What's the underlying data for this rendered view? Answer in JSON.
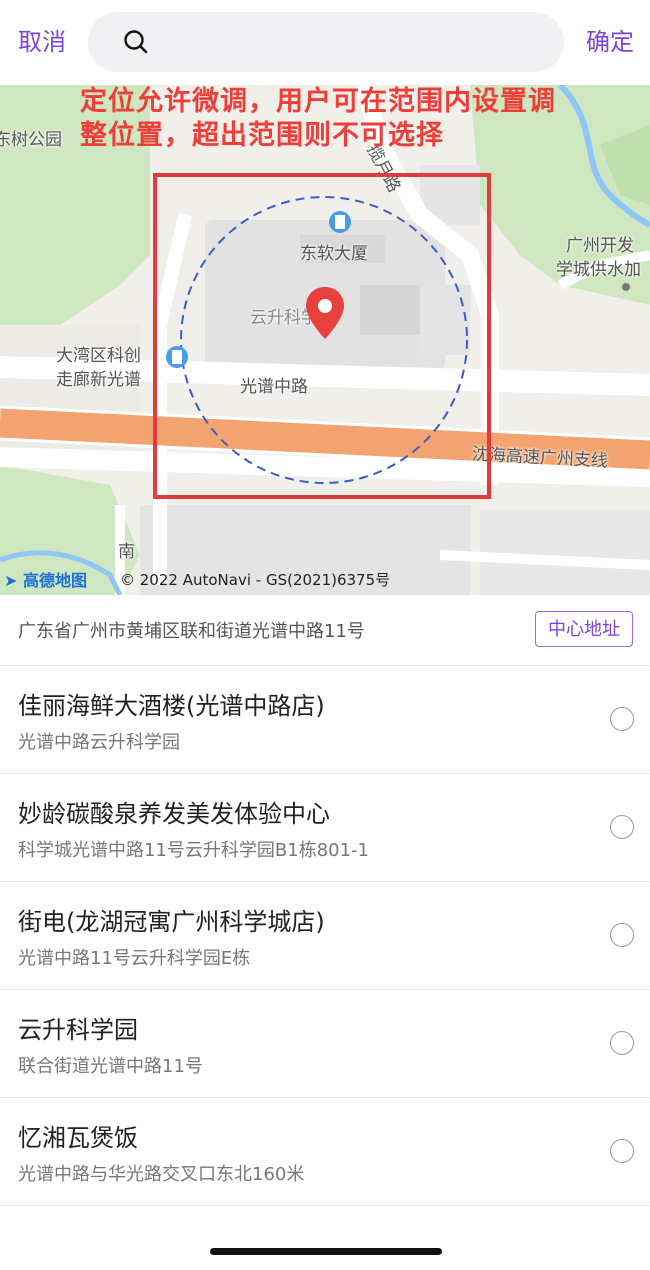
{
  "header": {
    "cancel_label": "取消",
    "confirm_label": "确定",
    "search_placeholder": "",
    "search_icon": "search-icon"
  },
  "map": {
    "overlay_note": "定位允许微调，用户可在范围内设置调整位置，超出范围则不可选择",
    "labels": {
      "park": "东树公园",
      "road_lanyue": "揽月路",
      "building": "东软大厦",
      "science_park": "云升科学园",
      "dawan": "大湾区科创",
      "zoulang": "走廊新光谱",
      "guangpu_road": "光谱中路",
      "expressway": "沈海高速广州支线",
      "water_supply_1": "广州开发",
      "water_supply_2": "学城供水加",
      "south": "南"
    },
    "logo_text": "高德地图",
    "copyright": "© 2022 AutoNavi - GS(2021)6375号",
    "colors": {
      "range_box": "#e23a3f",
      "range_circle": "#3a5cc9",
      "pin": "#e8403d"
    }
  },
  "address": {
    "text": "广东省广州市黄埔区联和街道光谱中路11号",
    "center_button": "中心地址"
  },
  "poi_list": [
    {
      "name": "佳丽海鲜大酒楼(光谱中路店)",
      "address": "光谱中路云升科学园"
    },
    {
      "name": "妙龄碳酸泉养发美发体验中心",
      "address": "科学城光谱中路11号云升科学园B1栋801-1"
    },
    {
      "name": "街电(龙湖冠寓广州科学城店)",
      "address": "光谱中路11号云升科学园E栋"
    },
    {
      "name": "云升科学园",
      "address": "联合街道光谱中路11号"
    },
    {
      "name": "忆湘瓦煲饭",
      "address": "光谱中路与华光路交叉口东北160米"
    }
  ],
  "theme": {
    "accent": "#7b45e0"
  }
}
